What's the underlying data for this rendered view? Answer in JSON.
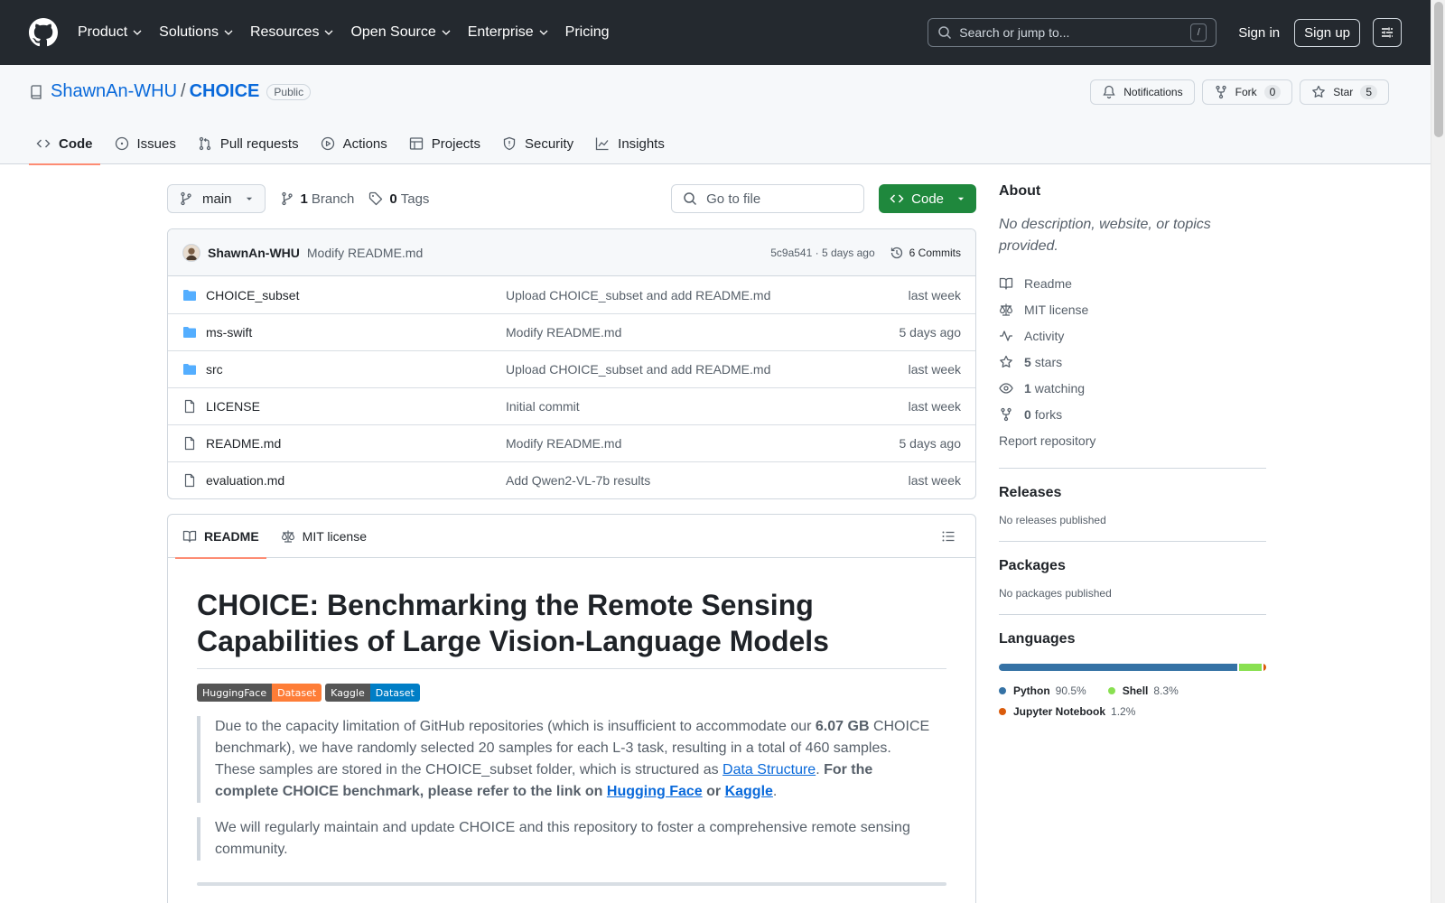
{
  "header": {
    "nav": [
      "Product",
      "Solutions",
      "Resources",
      "Open Source",
      "Enterprise",
      "Pricing"
    ],
    "search_placeholder": "Search or jump to...",
    "search_shortcut": "/",
    "signin": "Sign in",
    "signup": "Sign up"
  },
  "repo": {
    "owner": "ShawnAn-WHU",
    "sep": "/",
    "name": "CHOICE",
    "visibility": "Public",
    "notifications": "Notifications",
    "fork_label": "Fork",
    "fork_count": "0",
    "star_label": "Star",
    "star_count": "5",
    "tabs": [
      "Code",
      "Issues",
      "Pull requests",
      "Actions",
      "Projects",
      "Security",
      "Insights"
    ]
  },
  "toolbar": {
    "branch": "main",
    "branch_count": "1",
    "branch_label": "Branch",
    "tag_count": "0",
    "tag_label": "Tags",
    "goto_placeholder": "Go to file",
    "code_label": "Code"
  },
  "commit": {
    "author": "ShawnAn-WHU",
    "message": "Modify README.md",
    "meta": "5c9a541 · 5 days ago",
    "count": "6 Commits"
  },
  "files": [
    {
      "name": "CHOICE_subset",
      "type": "dir",
      "message": "Upload CHOICE_subset and add README.md",
      "date": "last week"
    },
    {
      "name": "ms-swift",
      "type": "dir",
      "message": "Modify README.md",
      "date": "5 days ago"
    },
    {
      "name": "src",
      "type": "dir",
      "message": "Upload CHOICE_subset and add README.md",
      "date": "last week"
    },
    {
      "name": "LICENSE",
      "type": "file",
      "message": "Initial commit",
      "date": "last week"
    },
    {
      "name": "README.md",
      "type": "file",
      "message": "Modify README.md",
      "date": "5 days ago"
    },
    {
      "name": "evaluation.md",
      "type": "file",
      "message": "Add Qwen2-VL-7b results",
      "date": "last week"
    }
  ],
  "readme": {
    "tab_readme": "README",
    "tab_license": "MIT license",
    "title": "CHOICE: Benchmarking the Remote Sensing Capabilities of Large Vision-Language Models",
    "badge1_left": "HuggingFace",
    "badge1_right": "Dataset",
    "badge2_left": "Kaggle",
    "badge2_right": "Dataset",
    "quote1_a": "Due to the capacity limitation of GitHub repositories (which is insufficient to accommodate our ",
    "quote1_b": "6.07 GB",
    "quote1_c": " CHOICE benchmark), we have randomly selected 20 samples for each L-3 task, resulting in a total of 460 samples. These samples are stored in the CHOICE_subset folder, which is structured as ",
    "quote1_link": "Data Structure",
    "quote1_d": ". ",
    "quote1_bold": "For the complete CHOICE benchmark, please refer to the link on ",
    "quote1_hf": "Hugging Face",
    "quote1_or": " or ",
    "quote1_kaggle": "Kaggle",
    "quote1_end": ".",
    "quote2": "We will regularly maintain and update CHOICE and this repository to foster a comprehensive remote sensing community."
  },
  "about": {
    "heading": "About",
    "desc": "No description, website, or topics provided.",
    "readme": "Readme",
    "license": "MIT license",
    "activity": "Activity",
    "stars_count": "5",
    "stars_label": "stars",
    "watching_count": "1",
    "watching_label": "watching",
    "forks_count": "0",
    "forks_label": "forks",
    "report": "Report repository"
  },
  "releases": {
    "heading": "Releases",
    "text": "No releases published"
  },
  "packages": {
    "heading": "Packages",
    "text": "No packages published"
  },
  "languages": {
    "heading": "Languages",
    "items": [
      {
        "name": "Python",
        "pct": "90.5%",
        "value": 90.5,
        "color": "#3572A5"
      },
      {
        "name": "Shell",
        "pct": "8.3%",
        "value": 8.3,
        "color": "#89e051"
      },
      {
        "name": "Jupyter Notebook",
        "pct": "1.2%",
        "value": 1.2,
        "color": "#DA5B0B"
      }
    ]
  },
  "colors": {
    "header_bg": "#24292f",
    "link": "#0969da",
    "primary_button": "#1f883d",
    "tab_underline": "#fd8c73"
  }
}
